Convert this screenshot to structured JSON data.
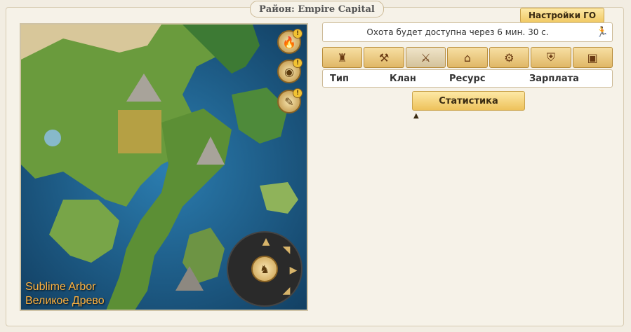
{
  "window": {
    "title": "Район: Empire Capital"
  },
  "settings_button": "Настройки ГО",
  "map": {
    "region_name_en": "Sublime Arbor",
    "region_name_ru": "Великое Древо",
    "side_buttons": [
      {
        "icon": "fire-shield-icon",
        "glyph": "🔥",
        "badge": "!"
      },
      {
        "icon": "world-globe-icon",
        "glyph": "◉",
        "badge": "!"
      },
      {
        "icon": "scroll-icon",
        "glyph": "✎",
        "badge": "!"
      }
    ],
    "compass": {
      "up": "▲",
      "up_right": "◥",
      "right": "▶",
      "down_right": "◢",
      "center": "♞"
    }
  },
  "hunt_status": "Охота будет доступна через 6 мин. 30 с.",
  "tabs": [
    {
      "icon": "castle-icon",
      "glyph": "♜"
    },
    {
      "icon": "forge-icon",
      "glyph": "⚒"
    },
    {
      "icon": "crossed-swords-icon",
      "glyph": "⚔"
    },
    {
      "icon": "house-icon",
      "glyph": "⌂"
    },
    {
      "icon": "mill-icon",
      "glyph": "⚙"
    },
    {
      "icon": "guild-shield-icon",
      "glyph": "⛨"
    },
    {
      "icon": "workshop-icon",
      "glyph": "▣"
    }
  ],
  "table": {
    "columns": [
      "Тип",
      "Клан",
      "Ресурс",
      "Зарплата"
    ]
  },
  "stats_button": "Статистика",
  "sort_arrow": "▲"
}
